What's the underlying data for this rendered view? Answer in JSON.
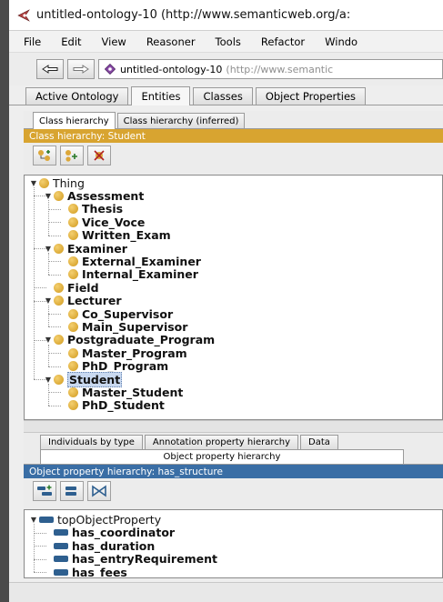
{
  "window": {
    "title": "untitled-ontology-10 (http://www.semanticweb.org/a:"
  },
  "menu": [
    "File",
    "Edit",
    "View",
    "Reasoner",
    "Tools",
    "Refactor",
    "Windo"
  ],
  "toolbar": {
    "ontology_name": "untitled-ontology-10",
    "ontology_uri": "(http://www.semantic"
  },
  "main_tabs": [
    "Active Ontology",
    "Entities",
    "Classes",
    "Object Properties"
  ],
  "class_panel": {
    "tabs": [
      "Class hierarchy",
      "Class hierarchy (inferred)"
    ],
    "header": "Class hierarchy: Student",
    "tree": [
      {
        "label": "Thing",
        "depth": 0,
        "root": true
      },
      {
        "label": "Assessment",
        "depth": 1
      },
      {
        "label": "Thesis",
        "depth": 2
      },
      {
        "label": "Vice_Voce",
        "depth": 2
      },
      {
        "label": "Written_Exam",
        "depth": 2
      },
      {
        "label": "Examiner",
        "depth": 1
      },
      {
        "label": "External_Examiner",
        "depth": 2
      },
      {
        "label": "Internal_Examiner",
        "depth": 2
      },
      {
        "label": "Field",
        "depth": 1
      },
      {
        "label": "Lecturer",
        "depth": 1
      },
      {
        "label": "Co_Supervisor",
        "depth": 2
      },
      {
        "label": "Main_Supervisor",
        "depth": 2
      },
      {
        "label": "Postgraduate_Program",
        "depth": 1
      },
      {
        "label": "Master_Program",
        "depth": 2
      },
      {
        "label": "PhD_Program",
        "depth": 2
      },
      {
        "label": "Student",
        "depth": 1,
        "selected": true
      },
      {
        "label": "Master_Student",
        "depth": 2
      },
      {
        "label": "PhD_Student",
        "depth": 2
      }
    ]
  },
  "property_panel": {
    "tabs_row1": [
      "Individuals by type",
      "Annotation property hierarchy",
      "Data"
    ],
    "tabs_row2": [
      "Object property hierarchy"
    ],
    "header": "Object property hierarchy: has_structure",
    "tree": [
      {
        "label": "topObjectProperty",
        "depth": 0,
        "root": true
      },
      {
        "label": "has_coordinator",
        "depth": 1
      },
      {
        "label": "has_duration",
        "depth": 1
      },
      {
        "label": "has_entryRequirement",
        "depth": 1
      },
      {
        "label": "has_fees",
        "depth": 1
      }
    ]
  },
  "colors": {
    "class_header": "#d8a430",
    "property_header": "#3a6ea5",
    "class_icon": "#e2b040",
    "property_icon": "#2e5f8f"
  }
}
